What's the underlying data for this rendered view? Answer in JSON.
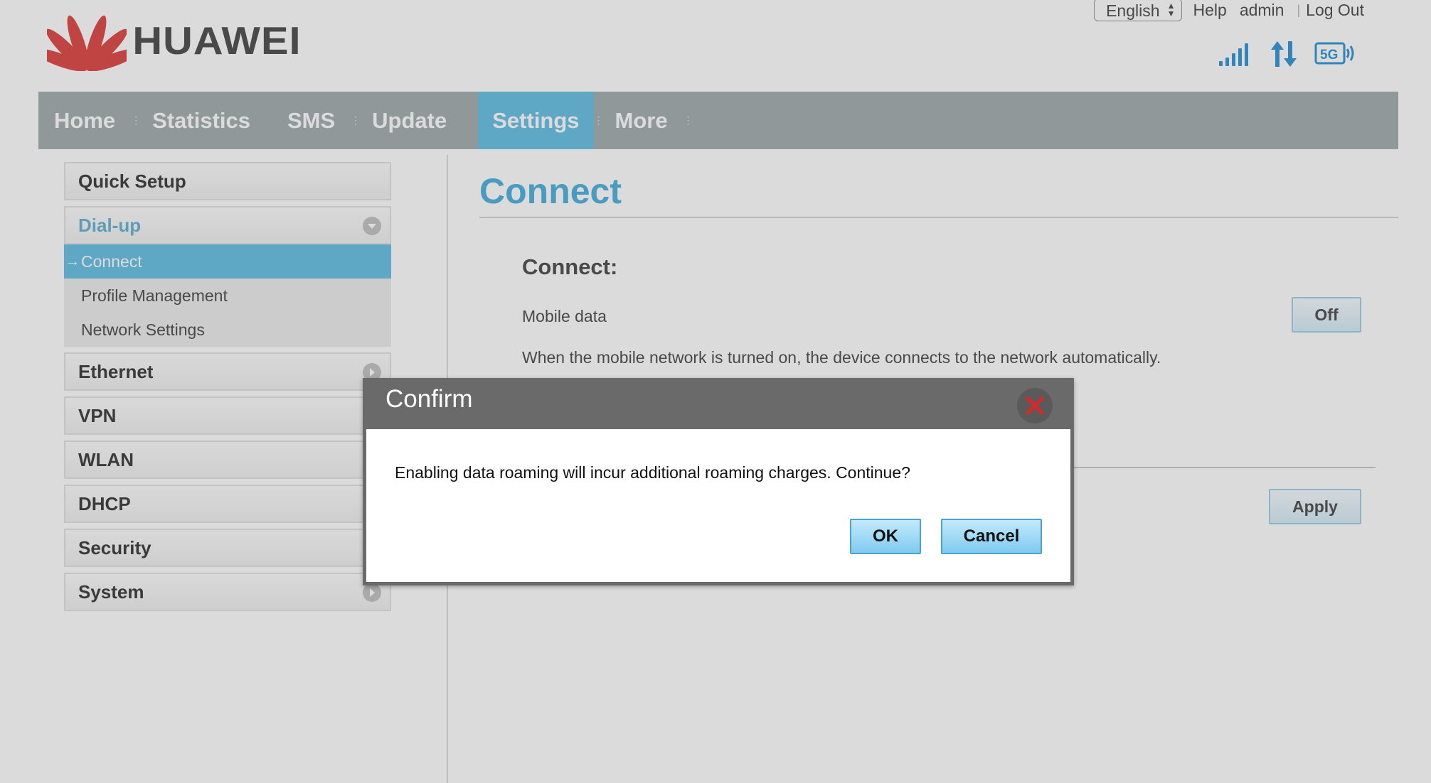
{
  "brand": {
    "name": "HUAWEI",
    "logo_icon": "huawei-petal-logo-icon",
    "logo_color": "#e0504d"
  },
  "toplinks": {
    "language": "English",
    "help": "Help",
    "user": "admin",
    "logout": "Log Out"
  },
  "status_icons": [
    "signal-strength-icon",
    "data-transfer-icon",
    "5g-network-icon"
  ],
  "nav": {
    "items": [
      "Home",
      "Statistics",
      "SMS",
      "Update",
      "Settings",
      "More"
    ],
    "active": "Settings"
  },
  "sidebar": {
    "quick_setup": "Quick Setup",
    "dialup": {
      "label": "Dial-up",
      "items": [
        "Connect",
        "Profile Management",
        "Network Settings"
      ],
      "active": "Connect"
    },
    "groups": [
      "Ethernet",
      "VPN",
      "WLAN",
      "DHCP",
      "Security",
      "System"
    ]
  },
  "main": {
    "title": "Connect",
    "section": "Connect:",
    "mobile_data_label": "Mobile data",
    "mobile_data_button": "Off",
    "description": "When the mobile network is turned on, the device connects to the network automatically.",
    "apply": "Apply"
  },
  "dialog": {
    "title": "Confirm",
    "message": "Enabling data roaming will incur additional roaming charges. Continue?",
    "ok": "OK",
    "cancel": "Cancel",
    "close_icon": "close-icon"
  },
  "colors": {
    "accent": "#6fc4e6",
    "nav_bg": "#a9b1b4",
    "title_blue": "#55b5e0",
    "close_red": "#d8262a"
  }
}
